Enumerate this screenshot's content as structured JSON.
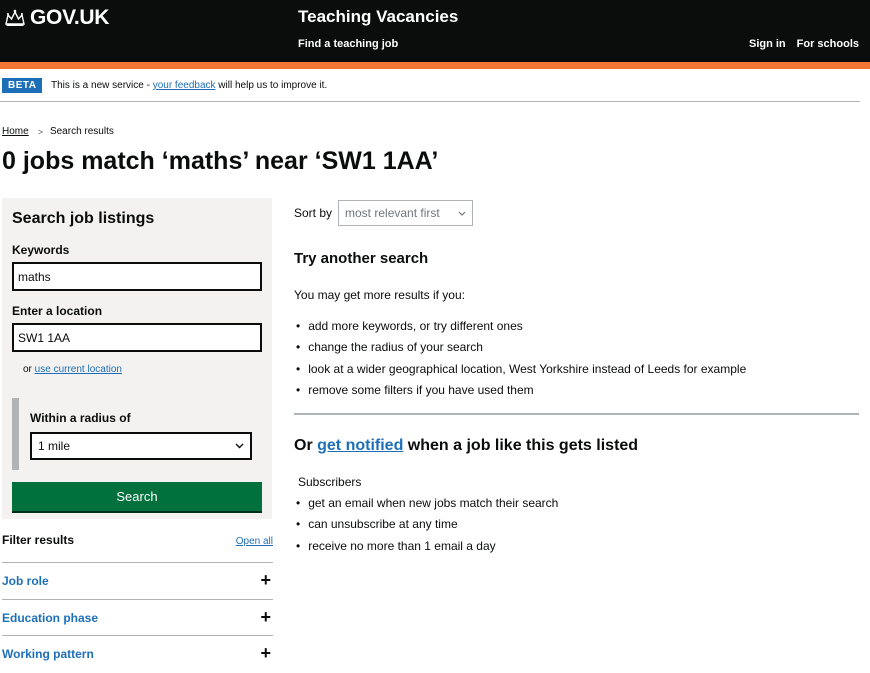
{
  "header": {
    "logo_text": "GOV.UK",
    "service_name": "Teaching Vacancies",
    "service_link": "Find a teaching job",
    "nav": [
      "Sign in",
      "For schools"
    ]
  },
  "phase_banner": {
    "tag": "BETA",
    "text_before": "This is a new service - ",
    "link": "your feedback",
    "text_after": " will help us to improve it."
  },
  "breadcrumb": {
    "home": "Home",
    "current": "Search results"
  },
  "title": {
    "count": "0",
    "text1": " jobs match ",
    "keyword": "‘maths’",
    "text2": " near ",
    "location": "‘SW1 1AA’"
  },
  "search_panel": {
    "title": "Search job listings",
    "keywords_label": "Keywords",
    "keywords_value": "maths",
    "location_label": "Enter a location",
    "location_value": "SW1 1AA",
    "or_text": "or ",
    "current_location_link": "use current location",
    "radius_label": "Within a radius of",
    "radius_value": "1 mile",
    "search_button": "Search"
  },
  "filters": {
    "title": "Filter results",
    "open_all": "Open all",
    "items": [
      "Job role",
      "Education phase",
      "Working pattern"
    ]
  },
  "sort": {
    "label": "Sort by",
    "value": "most relevant first"
  },
  "try_another": {
    "heading": "Try another search",
    "intro": "You may get more results if you:",
    "bullets": [
      "add more keywords, or try different ones",
      "change the radius of your search",
      "look at a wider geographical location, West Yorkshire instead of Leeds for example",
      "remove some filters if you have used them"
    ]
  },
  "notify": {
    "heading_before": "Or ",
    "heading_link": "get notified",
    "heading_after": " when a job like this gets listed",
    "subscribers": "Subscribers",
    "bullets": [
      "get an email when new jobs match their search",
      "can unsubscribe at any time",
      "receive no more than 1 email a day"
    ]
  },
  "colors": {
    "header_bg": "#0b0c0c",
    "accent_orange": "#f47738",
    "link_blue": "#1d70b8",
    "button_green": "#00703c",
    "panel_grey": "#f3f2f1"
  },
  "icons": [
    "crown-icon",
    "chevron-right-icon",
    "chevron-down-icon",
    "plus-icon"
  ]
}
